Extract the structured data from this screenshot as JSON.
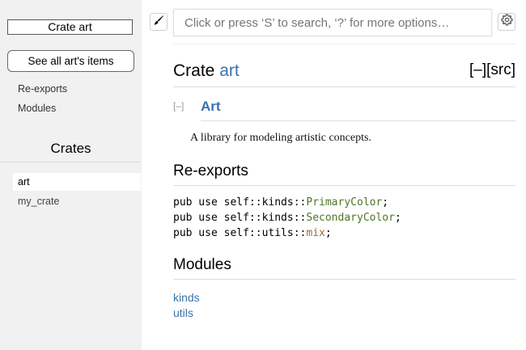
{
  "sidebar": {
    "crate_box_label": "Crate art",
    "all_items_button": "See all art's items",
    "links": [
      "Re-exports",
      "Modules"
    ],
    "crates_title": "Crates",
    "crates": [
      "art",
      "my_crate"
    ]
  },
  "header": {
    "brush_icon": "paintbrush-icon",
    "search_placeholder": "Click or press ‘S’ to search, ‘?’ for more options…",
    "settings_icon": "gear-icon"
  },
  "main": {
    "title_prefix": "Crate ",
    "title_name": "art",
    "collapse_all": "[–]",
    "src_link": "[src]",
    "toggle": "[–]",
    "heading": "Art",
    "description": "A library for modeling artistic concepts.",
    "reexports_heading": "Re-exports",
    "reexports": [
      {
        "prefix": "pub use self::kinds::",
        "name": "PrimaryColor",
        "kind": "struct",
        "suffix": ";"
      },
      {
        "prefix": "pub use self::kinds::",
        "name": "SecondaryColor",
        "kind": "struct",
        "suffix": ";"
      },
      {
        "prefix": "pub use self::utils::",
        "name": "mix",
        "kind": "fn",
        "suffix": ";"
      }
    ],
    "modules_heading": "Modules",
    "modules": [
      "kinds",
      "utils"
    ]
  },
  "colors": {
    "link": "#3873ad",
    "struct": "#4d7624",
    "fn": "#9a6e31",
    "sidebar_bg": "#f1f1f1"
  }
}
